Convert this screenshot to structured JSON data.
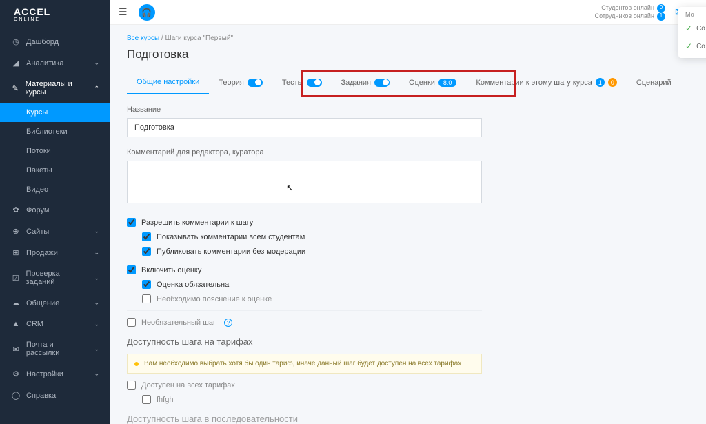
{
  "brand": {
    "title": "ACCEL",
    "sub": "ONLINE"
  },
  "sidebar": {
    "items": [
      {
        "icon": "◔",
        "label": "Дашборд",
        "chev": false
      },
      {
        "icon": "◢",
        "label": "Аналитика",
        "chev": true
      },
      {
        "icon": "✎",
        "label": "Материалы и курсы",
        "chev": true,
        "expanded": true,
        "children": [
          {
            "label": "Курсы",
            "active": true
          },
          {
            "label": "Библиотеки"
          },
          {
            "label": "Потоки"
          },
          {
            "label": "Пакеты"
          },
          {
            "label": "Видео"
          }
        ]
      },
      {
        "icon": "✿",
        "label": "Форум",
        "chev": false
      },
      {
        "icon": "⊕",
        "label": "Сайты",
        "chev": true
      },
      {
        "icon": "⊞",
        "label": "Продажи",
        "chev": true
      },
      {
        "icon": "☑",
        "label": "Проверка заданий",
        "chev": true
      },
      {
        "icon": "✉",
        "label": "Общение",
        "chev": true
      },
      {
        "icon": "▲",
        "label": "CRM",
        "chev": true
      },
      {
        "icon": "✉",
        "label": "Почта и рассылки",
        "chev": true
      },
      {
        "icon": "⚙",
        "label": "Настройки",
        "chev": true
      },
      {
        "icon": "◯",
        "label": "Справка",
        "chev": false
      }
    ]
  },
  "topbar": {
    "students_label": "Студентов онлайн",
    "students_count": "0",
    "staff_label": "Сотрудников онлайн",
    "staff_count": "1",
    "popup": {
      "row1": "Со",
      "row2": "Со",
      "extra": "Мо"
    }
  },
  "breadcrumb": {
    "all": "Все курсы",
    "sep": " / ",
    "current": "Шаги курса \"Первый\""
  },
  "page_title": "Подготовка",
  "tabs": {
    "general": "Общие настройки",
    "theory": "Теория",
    "tests": "Тесты",
    "tasks": "Задания",
    "grades": "Оценки",
    "grade_score": "8.0",
    "comments": "Комментарии к этому шагу курса",
    "c_badge1": "1",
    "c_badge2": "0",
    "scenario": "Сценарий"
  },
  "form": {
    "name_label": "Название",
    "name_value": "Подготовка",
    "comment_label": "Комментарий для редактора, куратора",
    "allow_comments": "Разрешить комментарии к шагу",
    "show_comments": "Показывать комментарии всем студентам",
    "publish_no_mod": "Публиковать комментарии без модерации",
    "enable_grade": "Включить оценку",
    "grade_required": "Оценка обязательна",
    "need_explain": "Необходимо пояснение к оценке",
    "optional_step": "Необязательный шаг",
    "tariffs_title": "Доступность шага на тарифах",
    "warning_text": "Вам необходимо выбрать хотя бы один тариф, иначе данный шаг будет доступен на всех тарифах",
    "all_tariffs": "Доступен на всех тарифах",
    "tariff_1": "fhfgh",
    "sequence_title": "Доступность шага в последовательности"
  }
}
